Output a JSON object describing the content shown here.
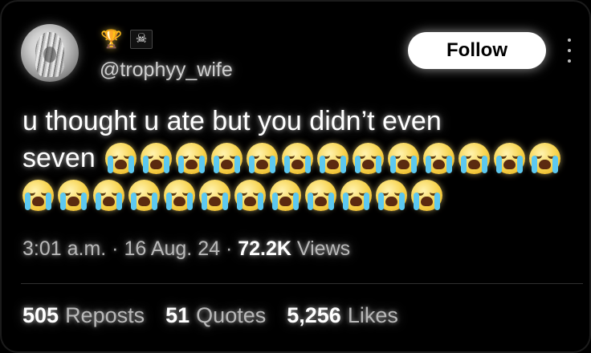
{
  "author": {
    "handle": "@trophyy_wife",
    "badges": [
      {
        "icon": "trophy-icon",
        "glyph": "🏆"
      },
      {
        "icon": "pirate-flag-icon",
        "glyph": "☠"
      }
    ]
  },
  "actions": {
    "follow_label": "Follow"
  },
  "tweet": {
    "line1": "u thought u ate but you didn’t even",
    "line2": "seven",
    "emoji_icon": "loudly-crying-face-icon",
    "emoji_count_line2": 13,
    "emoji_count_line3": 12
  },
  "meta": {
    "time": "3:01 a.m.",
    "sep1": " · ",
    "date": "16 Aug. 24",
    "sep2": " · ",
    "views_count": "72.2K",
    "views_label": " Views"
  },
  "stats": {
    "reposts_count": "505",
    "reposts_label": "Reposts",
    "quotes_count": "51",
    "quotes_label": "Quotes",
    "likes_count": "5,256",
    "likes_label": "Likes"
  },
  "colors": {
    "background": "#000000",
    "text": "#ffffff",
    "muted": "#b9b9b9",
    "follow_bg": "#ffffff"
  }
}
